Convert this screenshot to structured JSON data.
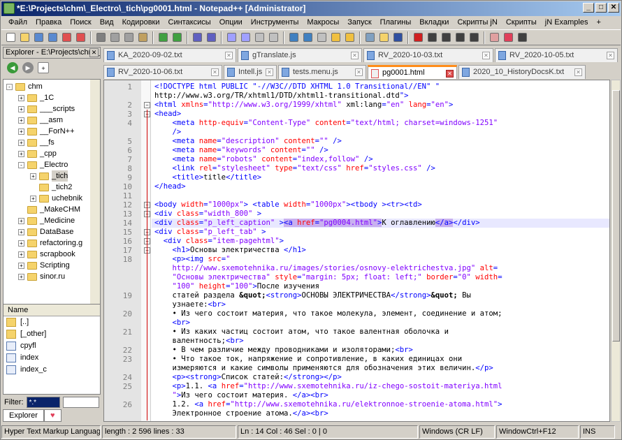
{
  "window": {
    "title": "*E:\\Projects\\chm\\_Electro\\_tich\\pg0001.html - Notepad++ [Administrator]",
    "min": "_",
    "max": "□",
    "close": "✕"
  },
  "menu": [
    "Файл",
    "Правка",
    "Поиск",
    "Вид",
    "Кодировки",
    "Синтаксисы",
    "Опции",
    "Инструменты",
    "Макросы",
    "Запуск",
    "Плагины",
    "Вкладки",
    "Скрипты jN",
    "Скрипты",
    "jN Examples",
    "+"
  ],
  "toolbar": [
    "new-icon",
    "open-icon",
    "save-icon",
    "save-all-icon",
    "close-icon",
    "close-all-icon",
    "print-icon",
    "cut-icon",
    "copy-icon",
    "paste-icon",
    "undo-icon",
    "redo-icon",
    "find-icon",
    "replace-icon",
    "zoom-in-icon",
    "zoom-out-icon",
    "sync-v-icon",
    "sync-h-icon",
    "wrap-icon",
    "show-all-icon",
    "indent-guide-icon",
    "udl-icon",
    "doc-map-icon",
    "function-list-icon",
    "folder-workspace-icon",
    "monitor-icon",
    "record-icon",
    "stop-icon",
    "play-icon",
    "run-multiple-icon",
    "save-macro-icon",
    "spell-icon",
    "heart-icon",
    "hex-icon"
  ],
  "explorer": {
    "title": "Explorer - E:\\Projects\\chm\\_Electro",
    "close": "✕",
    "tree": [
      {
        "label": "chm",
        "level": 0,
        "pm": "-"
      },
      {
        "label": "_1C",
        "level": 1,
        "pm": "+"
      },
      {
        "label": "___scripts",
        "level": 1,
        "pm": "+"
      },
      {
        "label": "__asm",
        "level": 1,
        "pm": "+"
      },
      {
        "label": "__ForN++",
        "level": 1,
        "pm": "+"
      },
      {
        "label": "__fs",
        "level": 1,
        "pm": "+"
      },
      {
        "label": "_cpp",
        "level": 1,
        "pm": "+"
      },
      {
        "label": "_Electro",
        "level": 1,
        "pm": "-"
      },
      {
        "label": "_tich",
        "level": 2,
        "pm": "+",
        "selected": true
      },
      {
        "label": "_tich2",
        "level": 2,
        "pm": ""
      },
      {
        "label": "uchebnik",
        "level": 2,
        "pm": "+"
      },
      {
        "label": "_MakeCHM",
        "level": 1,
        "pm": ""
      },
      {
        "label": "_Medicine",
        "level": 1,
        "pm": "+"
      },
      {
        "label": "DataBase",
        "level": 1,
        "pm": "+"
      },
      {
        "label": "refactoring.g",
        "level": 1,
        "pm": "+"
      },
      {
        "label": "scrapbook",
        "level": 1,
        "pm": "+"
      },
      {
        "label": "Scripting",
        "level": 1,
        "pm": "+"
      },
      {
        "label": "sinor.ru",
        "level": 1,
        "pm": "+"
      }
    ],
    "files_header": "Name",
    "files": [
      "[..]",
      "[_other]",
      "cpyfl",
      "index",
      "index_c"
    ],
    "filter_label": "Filter:",
    "filter_value": "*.*",
    "tabs": [
      "Explorer",
      ""
    ]
  },
  "tabs_row1": [
    {
      "label": "KA_2020-09-02.txt",
      "w": 190
    },
    {
      "label": "gTranslate.js",
      "w": 178
    },
    {
      "label": "RV_2020-10-03.txt",
      "w": 186
    },
    {
      "label": "RV_2020-10-05.txt",
      "w": 176
    }
  ],
  "tabs_row2": [
    {
      "label": "RV_2020-10-06.txt",
      "w": 170,
      "active": false
    },
    {
      "label": "Intell.js",
      "w": 76,
      "active": false
    },
    {
      "label": "tests.menu.js",
      "w": 126,
      "active": false
    },
    {
      "label": "pg0001.html",
      "w": 128,
      "active": true
    },
    {
      "label": "2020_10_HistoryDocsK.txt",
      "w": 182,
      "active": false
    }
  ],
  "code": [
    {
      "n": "1",
      "t": [
        [
          "tg",
          "<!DOCTYPE html PUBLIC \"-//W3C//DTD XHTML 1.0 Transitional//EN\" \""
        ]
      ]
    },
    {
      "n": "",
      "t": [
        [
          "tx0",
          "http://www.w3.org/TR/xhtml1/DTD/xhtml1-transitional.dtd"
        ],
        [
          "tg",
          "\">"
        ]
      ]
    },
    {
      "n": "2",
      "t": [
        [
          "tg",
          "<html "
        ],
        [
          "at",
          "xmlns"
        ],
        [
          "tg",
          "="
        ],
        [
          "av",
          "\"http://www.w3.org/1999/xhtml\""
        ],
        [
          "tx0",
          " xml:lang"
        ],
        [
          "tg",
          "="
        ],
        [
          "av",
          "\"en\""
        ],
        [
          "at",
          " lang"
        ],
        [
          "tg",
          "="
        ],
        [
          "av",
          "\"en\""
        ],
        [
          "tg",
          ">"
        ]
      ]
    },
    {
      "n": "3",
      "t": [
        [
          "tg",
          "<head>"
        ]
      ]
    },
    {
      "n": "4",
      "t": [
        [
          "tg",
          "    <meta "
        ],
        [
          "at",
          "http-equiv"
        ],
        [
          "tg",
          "="
        ],
        [
          "av",
          "\"Content-Type\""
        ],
        [
          "at",
          " content"
        ],
        [
          "tg",
          "="
        ],
        [
          "av",
          "\"text/html; charset=windows-1251\""
        ]
      ]
    },
    {
      "n": "",
      "t": [
        [
          "tg",
          "    />"
        ]
      ]
    },
    {
      "n": "5",
      "t": [
        [
          "tg",
          "    <meta "
        ],
        [
          "at",
          "name"
        ],
        [
          "tg",
          "="
        ],
        [
          "av",
          "\"description\""
        ],
        [
          "at",
          " content"
        ],
        [
          "tg",
          "="
        ],
        [
          "av",
          "\"\""
        ],
        [
          "tg",
          " />"
        ]
      ]
    },
    {
      "n": "6",
      "t": [
        [
          "tg",
          "    <meta "
        ],
        [
          "at",
          "name"
        ],
        [
          "tg",
          "="
        ],
        [
          "av",
          "\"keywords\""
        ],
        [
          "at",
          " content"
        ],
        [
          "tg",
          "="
        ],
        [
          "av",
          "\"\""
        ],
        [
          "tg",
          " />"
        ]
      ]
    },
    {
      "n": "7",
      "t": [
        [
          "tg",
          "    <meta "
        ],
        [
          "at",
          "name"
        ],
        [
          "tg",
          "="
        ],
        [
          "av",
          "\"robots\""
        ],
        [
          "at",
          " content"
        ],
        [
          "tg",
          "="
        ],
        [
          "av",
          "\"index,follow\""
        ],
        [
          "tg",
          " />"
        ]
      ]
    },
    {
      "n": "8",
      "t": [
        [
          "tg",
          "    <link "
        ],
        [
          "at",
          "rel"
        ],
        [
          "tg",
          "="
        ],
        [
          "av",
          "\"stylesheet\""
        ],
        [
          "at",
          " type"
        ],
        [
          "tg",
          "="
        ],
        [
          "av",
          "\"text/css\""
        ],
        [
          "at",
          " href"
        ],
        [
          "tg",
          "="
        ],
        [
          "av",
          "\"styles.css\""
        ],
        [
          "tg",
          " />"
        ]
      ]
    },
    {
      "n": "9",
      "t": [
        [
          "tg",
          "    <title>"
        ],
        [
          "tx0",
          "title"
        ],
        [
          "tg",
          "</title>"
        ]
      ]
    },
    {
      "n": "10",
      "t": [
        [
          "tg",
          "</head>"
        ]
      ]
    },
    {
      "n": "11",
      "t": []
    },
    {
      "n": "12",
      "t": [
        [
          "tg",
          "<body "
        ],
        [
          "at",
          "width"
        ],
        [
          "tg",
          "="
        ],
        [
          "av",
          "\"1000px\""
        ],
        [
          "tg",
          "> <table "
        ],
        [
          "at",
          "width"
        ],
        [
          "tg",
          "="
        ],
        [
          "av",
          "\"1000px\""
        ],
        [
          "tg",
          "><tbody ><tr><td>"
        ]
      ]
    },
    {
      "n": "13",
      "t": [
        [
          "tg",
          "<div "
        ],
        [
          "at",
          "class"
        ],
        [
          "tg",
          "="
        ],
        [
          "av",
          "\"width_800\""
        ],
        [
          "tg",
          " >"
        ]
      ]
    },
    {
      "n": "14",
      "t": [
        [
          "tg",
          "<div "
        ],
        [
          "at",
          "class"
        ],
        [
          "tg",
          "="
        ],
        [
          "av",
          "\"p_left_caption\""
        ],
        [
          "tg",
          " >"
        ],
        [
          "tg hl",
          "<a "
        ],
        [
          "at hl",
          "href"
        ],
        [
          "tg hl",
          "="
        ],
        [
          "av hl",
          "\"pg0004.html\""
        ],
        [
          "tg hl",
          ">"
        ],
        [
          "tx0",
          "К оглавлению"
        ],
        [
          "tg hl",
          "</a>"
        ],
        [
          "tg",
          "</div>"
        ]
      ]
    },
    {
      "n": "15",
      "t": [
        [
          "tg",
          "<div "
        ],
        [
          "at",
          "class"
        ],
        [
          "tg",
          "="
        ],
        [
          "av",
          "\"p_left_tab\""
        ],
        [
          "tg",
          " >"
        ]
      ]
    },
    {
      "n": "16",
      "t": [
        [
          "tg",
          "  <div "
        ],
        [
          "at",
          "class"
        ],
        [
          "tg",
          "="
        ],
        [
          "av",
          "\"item-pagehtml\""
        ],
        [
          "tg",
          ">"
        ]
      ]
    },
    {
      "n": "17",
      "t": [
        [
          "tg",
          "    <h1>"
        ],
        [
          "tx0",
          "Основы электричества "
        ],
        [
          "tg",
          "</h1>"
        ]
      ]
    },
    {
      "n": "18",
      "t": [
        [
          "tg",
          "    <p><img "
        ],
        [
          "at",
          "src"
        ],
        [
          "tg",
          "="
        ],
        [
          "av",
          "\""
        ]
      ]
    },
    {
      "n": "",
      "t": [
        [
          "av",
          "    http://www.sxemotehnika.ru/images/stories/osnovy-elektrichestva.jpg\""
        ],
        [
          "at",
          " alt"
        ],
        [
          "tg",
          "="
        ]
      ]
    },
    {
      "n": "",
      "t": [
        [
          "av",
          "    \"Основы электричества\""
        ],
        [
          "at",
          " style"
        ],
        [
          "tg",
          "="
        ],
        [
          "av",
          "\"margin: 5px; float: left;\""
        ],
        [
          "at",
          " border"
        ],
        [
          "tg",
          "="
        ],
        [
          "av",
          "\"0\""
        ],
        [
          "at",
          " width"
        ],
        [
          "tg",
          "="
        ]
      ]
    },
    {
      "n": "",
      "t": [
        [
          "av",
          "    \"100\""
        ],
        [
          "at",
          " height"
        ],
        [
          "tg",
          "="
        ],
        [
          "av",
          "\"100\""
        ],
        [
          "tg",
          ">"
        ],
        [
          "tx0",
          "После изучения"
        ]
      ]
    },
    {
      "n": "19",
      "t": [
        [
          "tx0",
          "    статей раздела "
        ],
        [
          "en",
          "&quot;"
        ],
        [
          "tg",
          "<strong>"
        ],
        [
          "tx0",
          "ОСНОВЫ ЭЛЕКТРИЧЕСТВА"
        ],
        [
          "tg",
          "</strong>"
        ],
        [
          "en",
          "&quot;"
        ],
        [
          "tx0",
          " Вы"
        ]
      ]
    },
    {
      "n": "",
      "t": [
        [
          "tx0",
          "    узнаете:"
        ],
        [
          "tg",
          "<br>"
        ]
      ]
    },
    {
      "n": "20",
      "t": [
        [
          "tx0",
          "    • Из чего состоит материя, что такое молекула, элемент, соединение и атом;"
        ]
      ]
    },
    {
      "n": "",
      "t": [
        [
          "tg",
          "    <br>"
        ]
      ]
    },
    {
      "n": "21",
      "t": [
        [
          "tx0",
          "    • Из каких частиц состоит атом, что такое валентная оболочка и"
        ]
      ]
    },
    {
      "n": "",
      "t": [
        [
          "tx0",
          "    валентность;"
        ],
        [
          "tg",
          "<br>"
        ]
      ]
    },
    {
      "n": "22",
      "t": [
        [
          "tx0",
          "    • В чем различие между проводниками и изоляторами;"
        ],
        [
          "tg",
          "<br>"
        ]
      ]
    },
    {
      "n": "23",
      "t": [
        [
          "tx0",
          "    • Что такое ток, напряжение и сопротивление, в каких единицах они"
        ]
      ]
    },
    {
      "n": "",
      "t": [
        [
          "tx0",
          "    измеряются и какие символы применяются для обозначения этих величин."
        ],
        [
          "tg",
          "</p>"
        ]
      ]
    },
    {
      "n": "24",
      "t": [
        [
          "tg",
          "    <p><strong>"
        ],
        [
          "tx0",
          "Список статей:"
        ],
        [
          "tg",
          "</strong></p>"
        ]
      ]
    },
    {
      "n": "25",
      "t": [
        [
          "tg",
          "    <p>"
        ],
        [
          "tx0",
          "1.1. "
        ],
        [
          "tg",
          "<a "
        ],
        [
          "at",
          "href"
        ],
        [
          "tg",
          "="
        ],
        [
          "av",
          "\"http://www.sxemotehnika.ru/iz-chego-sostoit-materiya.html"
        ]
      ]
    },
    {
      "n": "",
      "t": [
        [
          "av",
          "    \""
        ],
        [
          "tg",
          ">"
        ],
        [
          "tx0",
          "Из чего состоит материя. "
        ],
        [
          "tg",
          "</a><br>"
        ]
      ]
    },
    {
      "n": "26",
      "t": [
        [
          "tx0",
          "    1.2. "
        ],
        [
          "tg",
          "<a "
        ],
        [
          "at",
          "href"
        ],
        [
          "tg",
          "="
        ],
        [
          "av",
          "\"http://www.sxemotehnika.ru/elektronnoe-stroenie-atoma.html\""
        ],
        [
          "tg",
          ">"
        ]
      ]
    },
    {
      "n": "",
      "t": [
        [
          "tx0",
          "    Электронное строение атома."
        ],
        [
          "tg",
          "</a><br>"
        ]
      ]
    }
  ],
  "status": [
    {
      "label": "Hyper Text Markup Language file",
      "w": 142
    },
    {
      "label": "length : 2 596    lines : 33",
      "w": 192
    },
    {
      "label": "Ln : 14    Col : 46    Sel : 0 | 0",
      "w": 258
    },
    {
      "label": "Windows (CR LF)",
      "w": 108
    },
    {
      "label": "WindowCtrl+F12",
      "w": 118
    },
    {
      "label": "INS",
      "w": 50
    }
  ]
}
